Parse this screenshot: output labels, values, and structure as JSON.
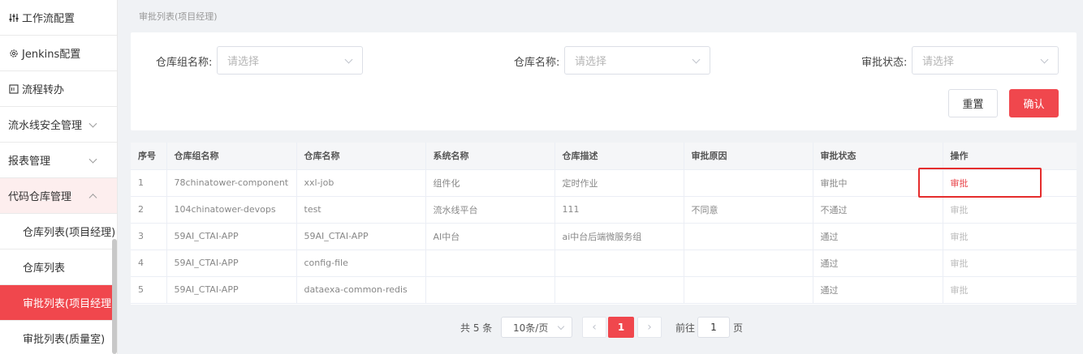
{
  "sidebar": {
    "items": [
      {
        "label": "工作流配置",
        "icon": "sliders-icon"
      },
      {
        "label": "Jenkins配置",
        "icon": "gear-icon"
      },
      {
        "label": "流程转办",
        "icon": "list-icon"
      },
      {
        "label": "流水线安全管理"
      },
      {
        "label": "报表管理"
      },
      {
        "label": "代码仓库管理"
      }
    ],
    "subitems": [
      {
        "label": "仓库列表(项目经理)"
      },
      {
        "label": "仓库列表"
      },
      {
        "label": "审批列表(项目经理)"
      },
      {
        "label": "审批列表(质量室)"
      }
    ]
  },
  "breadcrumb": "审批列表(项目经理)",
  "filters": {
    "group_label": "仓库组名称:",
    "group_placeholder": "请选择",
    "repo_label": "仓库名称:",
    "repo_placeholder": "请选择",
    "status_label": "审批状态:",
    "status_placeholder": "请选择",
    "reset_label": "重置",
    "confirm_label": "确认"
  },
  "table": {
    "headers": [
      "序号",
      "仓库组名称",
      "仓库名称",
      "系统名称",
      "仓库描述",
      "审批原因",
      "审批状态",
      "操作"
    ],
    "rows": [
      [
        "1",
        "78chinatower-component",
        "xxl-job",
        "组件化",
        "定时作业",
        "",
        "审批中",
        "审批"
      ],
      [
        "2",
        "104chinatower-devops",
        "test",
        "流水线平台",
        "111",
        "不同意",
        "不通过",
        "审批"
      ],
      [
        "3",
        "59AI_CTAI-APP",
        "59AI_CTAI-APP",
        "AI中台",
        "ai中台后端微服务组",
        "",
        "通过",
        "审批"
      ],
      [
        "4",
        "59AI_CTAI-APP",
        "config-file",
        "",
        "",
        "",
        "通过",
        "审批"
      ],
      [
        "5",
        "59AI_CTAI-APP",
        "dataexa-common-redis",
        "",
        "",
        "",
        "通过",
        "审批"
      ]
    ]
  },
  "pagination": {
    "total_text": "共 5 条",
    "page_size": "10条/页",
    "prev": "‹",
    "current": "1",
    "next": "›",
    "goto_label": "前往",
    "goto_value": "1",
    "goto_unit": "页"
  },
  "colors": {
    "accent": "#f0474d",
    "highlight": "#e52d2d"
  }
}
